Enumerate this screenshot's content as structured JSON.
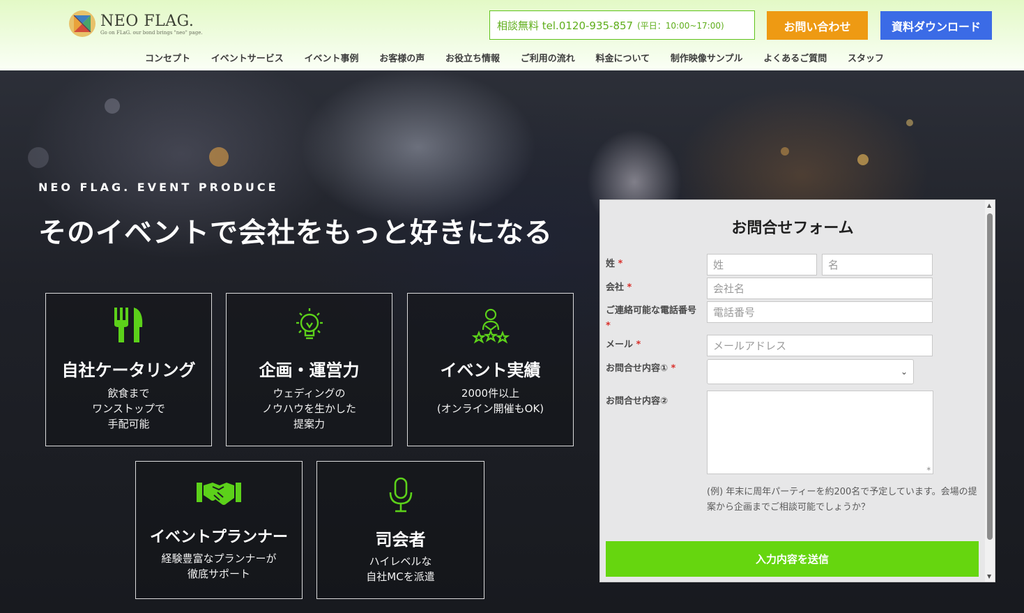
{
  "header": {
    "logo_name": "NEO FLAG.",
    "logo_tagline": "Go on FLaG. our bond brings \"neo\" page.",
    "tel": "相談無料 tel.0120-935-857",
    "tel_hours": "(平日：10:00~17:00)",
    "contact_button": "お問い合わせ",
    "download_button": "資料ダウンロード",
    "nav": [
      "コンセプト",
      "イベントサービス",
      "イベント事例",
      "お客様の声",
      "お役立ち情報",
      "ご利用の流れ",
      "料金について",
      "制作映像サンプル",
      "よくあるご質問",
      "スタッフ"
    ]
  },
  "hero": {
    "eyebrow": "NEO FLAG. EVENT PRODUCE",
    "headline": "そのイベントで会社をもっと好きになる",
    "features": [
      {
        "icon": "fork-knife-icon",
        "title": "自社ケータリング",
        "desc": "飲食まで\nワンストップで\n手配可能"
      },
      {
        "icon": "lightbulb-icon",
        "title": "企画・運営力",
        "desc": "ウェディングの\nノウハウを生かした\n提案力"
      },
      {
        "icon": "person-stars-icon",
        "title": "イベント実績",
        "desc": "2000件以上\n(オンライン開催もOK)"
      },
      {
        "icon": "handshake-icon",
        "title": "イベントプランナー",
        "desc": "経験豊富なプランナーが\n徹底サポート"
      },
      {
        "icon": "microphone-icon",
        "title": "司会者",
        "desc": "ハイレベルな\n自社MCを派遣"
      }
    ]
  },
  "form": {
    "title": "お問合せフォーム",
    "required_mark": "*",
    "labels": {
      "name": "姓",
      "company": "会社",
      "phone": "ご連絡可能な電話番号",
      "email": "メール",
      "inquiry1": "お問合せ内容①",
      "inquiry2": "お問合せ内容②"
    },
    "placeholders": {
      "last_name": "姓",
      "first_name": "名",
      "company": "会社名",
      "phone": "電話番号",
      "email": "メールアドレス"
    },
    "hint": "(例) 年末に周年パーティーを約200名で予定しています。会場の提案から企画までご相談可能でしょうか？",
    "submit": "入力内容を送信"
  },
  "colors": {
    "accent_green": "#66d60f",
    "orange": "#ee9a13",
    "blue": "#3b6be6",
    "icon_green": "#5cd11a"
  }
}
